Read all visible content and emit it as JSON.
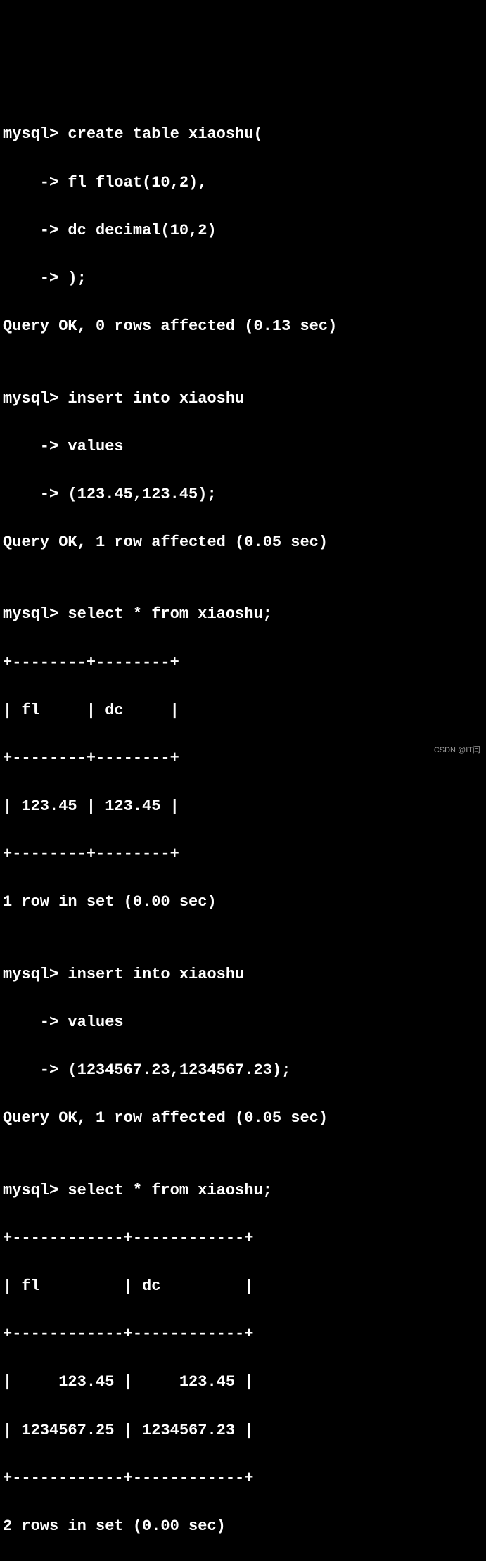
{
  "lines": [
    "mysql> create table xiaoshu(",
    "    -> fl float(10,2),",
    "    -> dc decimal(10,2)",
    "    -> );",
    "Query OK, 0 rows affected (0.13 sec)",
    "",
    "mysql> insert into xiaoshu",
    "    -> values",
    "    -> (123.45,123.45);",
    "Query OK, 1 row affected (0.05 sec)",
    "",
    "mysql> select * from xiaoshu;",
    "+--------+--------+",
    "| fl     | dc     |",
    "+--------+--------+",
    "| 123.45 | 123.45 |",
    "+--------+--------+",
    "1 row in set (0.00 sec)",
    "",
    "mysql> insert into xiaoshu",
    "    -> values",
    "    -> (1234567.23,1234567.23);",
    "Query OK, 1 row affected (0.05 sec)",
    "",
    "mysql> select * from xiaoshu;",
    "+------------+------------+",
    "| fl         | dc         |",
    "+------------+------------+",
    "|     123.45 |     123.45 |",
    "| 1234567.25 | 1234567.23 |",
    "+------------+------------+",
    "2 rows in set (0.00 sec)"
  ],
  "watermark": "CSDN @IT闫"
}
